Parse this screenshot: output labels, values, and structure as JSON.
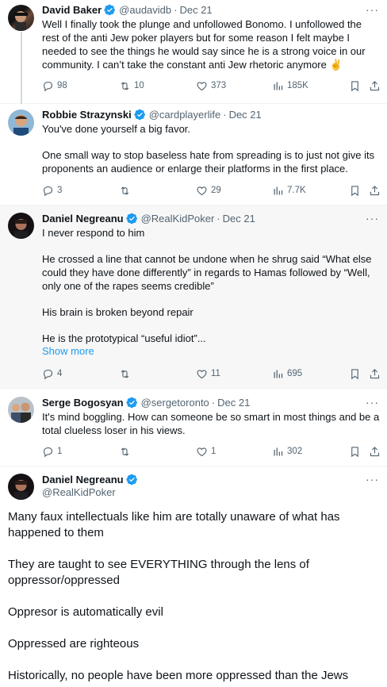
{
  "colors": {
    "blue": "#1d9bf0",
    "grey": "#536471",
    "verified": "#1d9bf0"
  },
  "tweets": [
    {
      "name": "David Baker",
      "handle": "@audavidb",
      "date": "Dec 21",
      "text": [
        "Well I finally took the plunge and unfollowed Bonomo. I unfollowed the rest of the anti Jew poker players but for some reason I felt maybe I needed to see the things he would say since he is a strong voice in our community. I can’t take the constant anti Jew rhetoric anymore ✌️"
      ],
      "replies": "98",
      "reposts": "10",
      "likes": "373",
      "views": "185K"
    },
    {
      "name": "Robbie Strazynski",
      "handle": "@cardplayerlife",
      "date": "Dec 21",
      "text": [
        "You've done yourself a big favor.",
        "One small way to stop baseless hate from spreading is to just not give its proponents an audience or enlarge their platforms in the first place."
      ],
      "replies": "3",
      "reposts": "",
      "likes": "29",
      "views": "7.7K"
    },
    {
      "name": "Daniel Negreanu",
      "handle": "@RealKidPoker",
      "date": "Dec 21",
      "text": [
        "I never respond to him",
        "He crossed a line that cannot be undone when he shrug said “What else could they have done differently” in regards to Hamas followed by “Well, only one of the rapes seems credible”",
        "His brain is broken beyond repair",
        "He is the prototypical “useful idiot”..."
      ],
      "show_more": "Show more",
      "replies": "4",
      "reposts": "",
      "likes": "11",
      "views": "695"
    },
    {
      "name": "Serge Bogosyan",
      "handle": "@sergetoronto",
      "date": "Dec 21",
      "text": [
        "It's mind boggling. How can someone be so smart in most things and be a total clueless loser in his views."
      ],
      "replies": "1",
      "reposts": "",
      "likes": "1",
      "views": "302"
    }
  ],
  "main_tweet": {
    "name": "Daniel Negreanu",
    "handle": "@RealKidPoker",
    "paragraphs": [
      "Many faux intellectuals like him are totally unaware of what has happened to them",
      "They are taught to see EVERYTHING through the lens of oppressor/oppressed",
      "Oppresor is automatically evil",
      "Oppressed are righteous",
      "Historically, no people have been more oppressed than the Jews"
    ]
  }
}
